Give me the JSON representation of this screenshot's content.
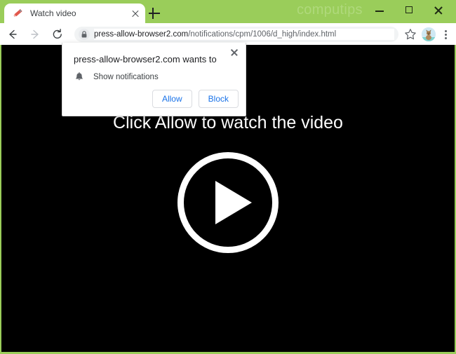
{
  "window": {
    "accent_color": "#9ACD5A",
    "watermark": "computips",
    "controls": {
      "minimize": "minimize-icon",
      "maximize": "maximize-icon",
      "close": "close-icon"
    }
  },
  "tab_strip": {
    "tabs": [
      {
        "title": "Watch video",
        "favicon": "megaphone-icon",
        "close_label": "close-tab-icon",
        "active": true
      }
    ],
    "new_tab_label": "new-tab-icon"
  },
  "toolbar": {
    "back_label": "back-arrow-icon",
    "forward_label": "forward-arrow-icon",
    "reload_label": "reload-icon",
    "security_icon": "lock-icon",
    "url_host": "press-allow-browser2.com",
    "url_path": "/notifications/cpm/1006/d_high/index.html",
    "url_full": "press-allow-browser2.com/notifications/cpm/1006/d_high/index.html",
    "bookmark_label": "star-icon",
    "profile_label": "profile-avatar",
    "menu_label": "three-dot-menu-icon"
  },
  "permission_dialog": {
    "title": "press-allow-browser2.com wants to",
    "option_icon": "bell-icon",
    "option_label": "Show notifications",
    "allow_label": "Allow",
    "block_label": "Block",
    "close_label": "close-icon",
    "accent_color": "#1a73e8"
  },
  "page": {
    "headline": "Click Allow to watch the video",
    "background_color": "#000000",
    "play_button_label": "play-button"
  }
}
